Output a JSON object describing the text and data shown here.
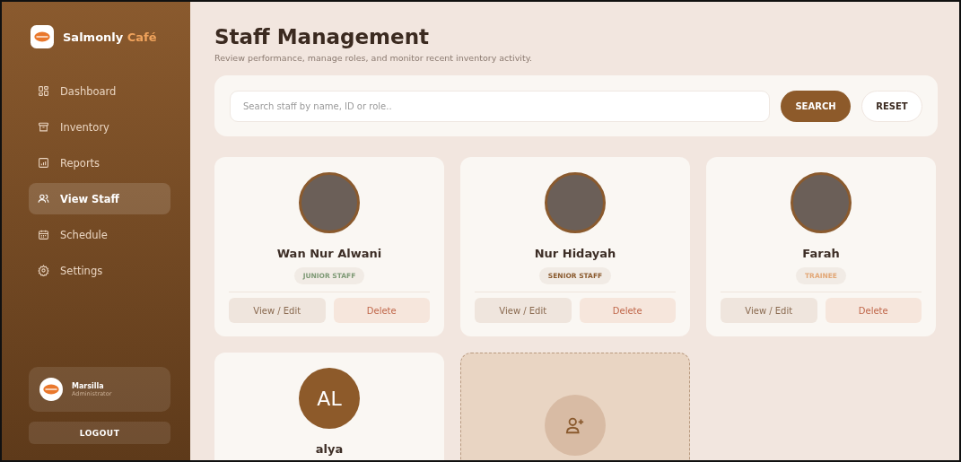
{
  "brand": {
    "name": "Salmonly",
    "accent": "Café"
  },
  "sidebar": {
    "items": [
      {
        "label": "Dashboard",
        "selected": false
      },
      {
        "label": "Inventory",
        "selected": false
      },
      {
        "label": "Reports",
        "selected": false
      },
      {
        "label": "View Staff",
        "selected": true
      },
      {
        "label": "Schedule",
        "selected": false
      },
      {
        "label": "Settings",
        "selected": false
      }
    ],
    "user": {
      "name": "Marsilla",
      "role": "Administrator"
    },
    "logout": "LOGOUT"
  },
  "header": {
    "title": "Staff Management",
    "subtitle": "Review performance, manage roles, and monitor recent inventory activity."
  },
  "search": {
    "placeholder": "Search staff by name, ID or role..",
    "search_button": "SEARCH",
    "reset_button": "RESET"
  },
  "staff": [
    {
      "kind": "photo",
      "name": "Wan Nur Alwani",
      "role": "JUNIOR STAFF",
      "color": "#7f9a76",
      "edit": "View / Edit",
      "delete": "Delete"
    },
    {
      "kind": "photo",
      "name": "Nur Hidayah",
      "role": "SENIOR STAFF",
      "color": "#8a5a2e",
      "edit": "View / Edit",
      "delete": "Delete"
    },
    {
      "kind": "photo",
      "name": "Farah",
      "role": "TRAINEE",
      "color": "#e3a877",
      "edit": "View / Edit",
      "delete": "Delete"
    },
    {
      "kind": "initials",
      "initials": "AL",
      "name": "alya"
    },
    {
      "kind": "add"
    }
  ]
}
